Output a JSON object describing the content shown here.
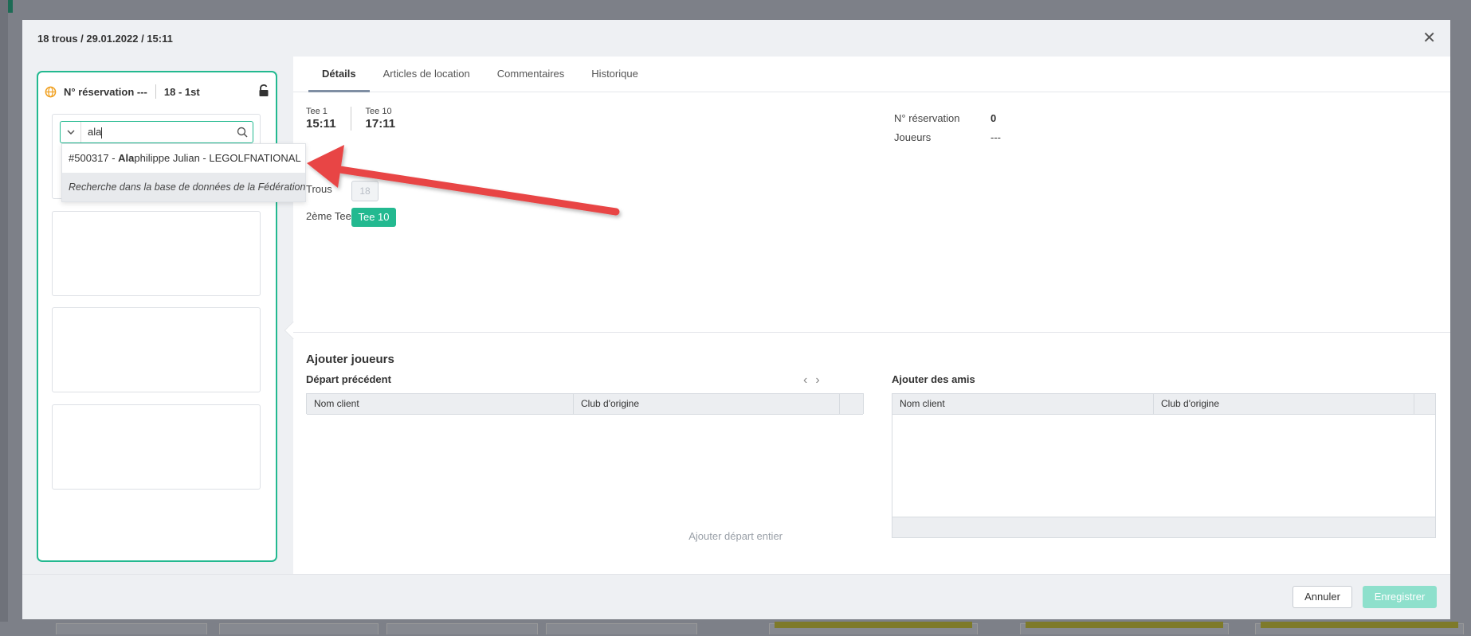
{
  "modal": {
    "title": "18 trous / 29.01.2022 / 15:11",
    "close_symbol": "✕"
  },
  "booking_card": {
    "booking_label": "N° réservation ---",
    "course": "18 - 1st",
    "search": {
      "value": "ala"
    }
  },
  "dropdown": {
    "result": {
      "prefix": "#500317 - ",
      "match": "Ala",
      "rest": "philippe Julian - LEGOLFNATIONAL"
    },
    "federation_search": "Recherche dans la base de données de la Fédération"
  },
  "tabs": [
    "Détails",
    "Articles de location",
    "Commentaires",
    "Historique"
  ],
  "details": {
    "tee1_label": "Tee 1",
    "tee1_time": "15:11",
    "tee10_label": "Tee 10",
    "tee10_time": "17:11",
    "trous_label": "Trous",
    "trous_value": "18",
    "second_tee_label": "2ème Tee",
    "second_tee_value": "Tee 10",
    "booking_no_label": "N° réservation",
    "booking_no_value": "0",
    "players_label": "Joueurs",
    "players_value": "---"
  },
  "add_players": {
    "title": "Ajouter joueurs",
    "previous": {
      "title": "Départ précédent",
      "columns": [
        "Nom client",
        "Club d'origine"
      ],
      "add_all": "Ajouter départ entier"
    },
    "friends": {
      "title": "Ajouter des amis",
      "columns": [
        "Nom client",
        "Club d'origine"
      ]
    }
  },
  "footer": {
    "cancel": "Annuler",
    "save": "Enregistrer"
  },
  "colors": {
    "accent": "#23b990",
    "save_disabled": "#8ee0cc",
    "annotation_arrow": "#e84545"
  }
}
